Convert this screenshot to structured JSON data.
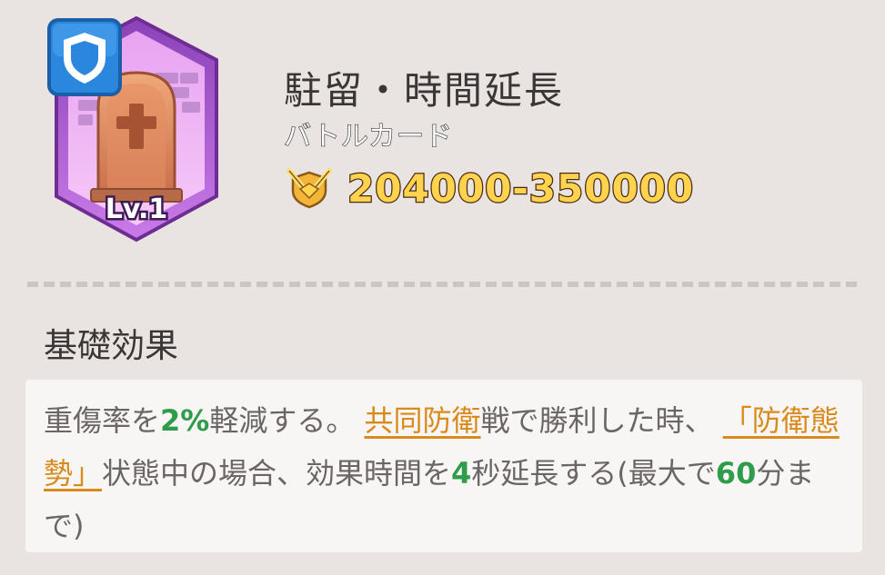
{
  "card": {
    "level": "Lv.1",
    "title": "駐留・時間延長",
    "type_label": "バトルカード",
    "power_range": "204000-350000",
    "icons": {
      "badge": "shield-icon",
      "art": "tombstone-icon",
      "power": "crossed-swords-shield-icon"
    }
  },
  "section": {
    "title": "基礎効果"
  },
  "effect": {
    "p1": "重傷率を",
    "v1": "2%",
    "p2": "軽減する。",
    "link1": "共同防衛",
    "p3": "戦で勝利した時、",
    "link2": "「防衛態勢」",
    "p4": "状態中の場合、効果時間を",
    "v2": "4",
    "p5": "秒延長する(最大で",
    "v3": "60",
    "p6": "分まで)"
  },
  "colors": {
    "background": "#e9e4e1",
    "highlight_number": "#2e9c4a",
    "link": "#d88b1c",
    "power_text": "#ffd34d"
  }
}
